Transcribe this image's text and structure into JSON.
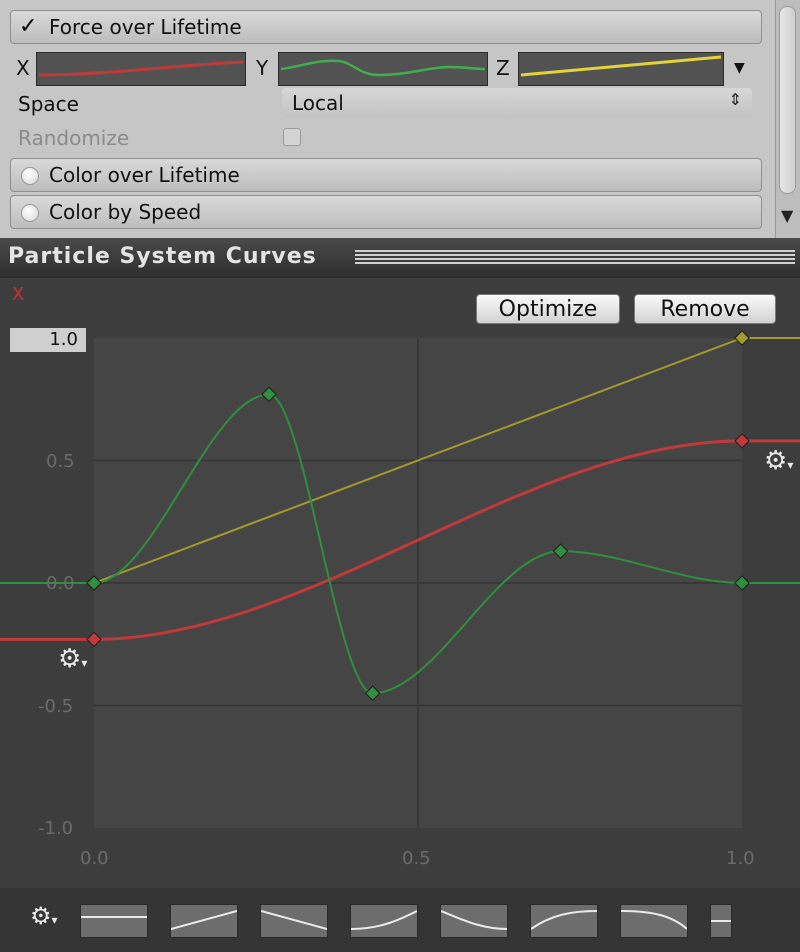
{
  "inspector": {
    "force_module": {
      "title": "Force over Lifetime",
      "axis_x": "X",
      "axis_y": "Y",
      "axis_z": "Z",
      "space_label": "Space",
      "space_value": "Local",
      "randomize_label": "Randomize",
      "randomize_checked": false
    },
    "color_lifetime_title": "Color over Lifetime",
    "color_speed_title": "Color by Speed"
  },
  "curves_panel": {
    "title": "Particle System Curves",
    "axis_label": "X",
    "optimize_label": "Optimize",
    "remove_label": "Remove",
    "max_value": "1.0",
    "y_ticks": [
      "0.5",
      "0.0",
      "-0.5",
      "-1.0"
    ],
    "x_ticks": [
      "0.0",
      "0.5",
      "1.0"
    ],
    "colors": {
      "x_curve": "#c0393b",
      "y_curve": "#2f8f3f",
      "z_curve": "#a39a2c"
    }
  },
  "chart_data": {
    "type": "line",
    "xlim": [
      0,
      1
    ],
    "ylim": [
      -1,
      1
    ],
    "series": [
      {
        "color": "#a39a2c",
        "keys": [
          [
            0.0,
            0.0
          ],
          [
            1.0,
            1.0
          ]
        ]
      },
      {
        "color": "#c0393b",
        "keys": [
          [
            0.0,
            -0.23
          ],
          [
            1.0,
            0.58
          ]
        ]
      },
      {
        "color": "#2f8f3f",
        "keys": [
          [
            0.0,
            0.0
          ],
          [
            0.27,
            0.77
          ],
          [
            0.43,
            -0.45
          ],
          [
            0.72,
            0.13
          ],
          [
            1.0,
            0.0
          ]
        ]
      }
    ]
  }
}
